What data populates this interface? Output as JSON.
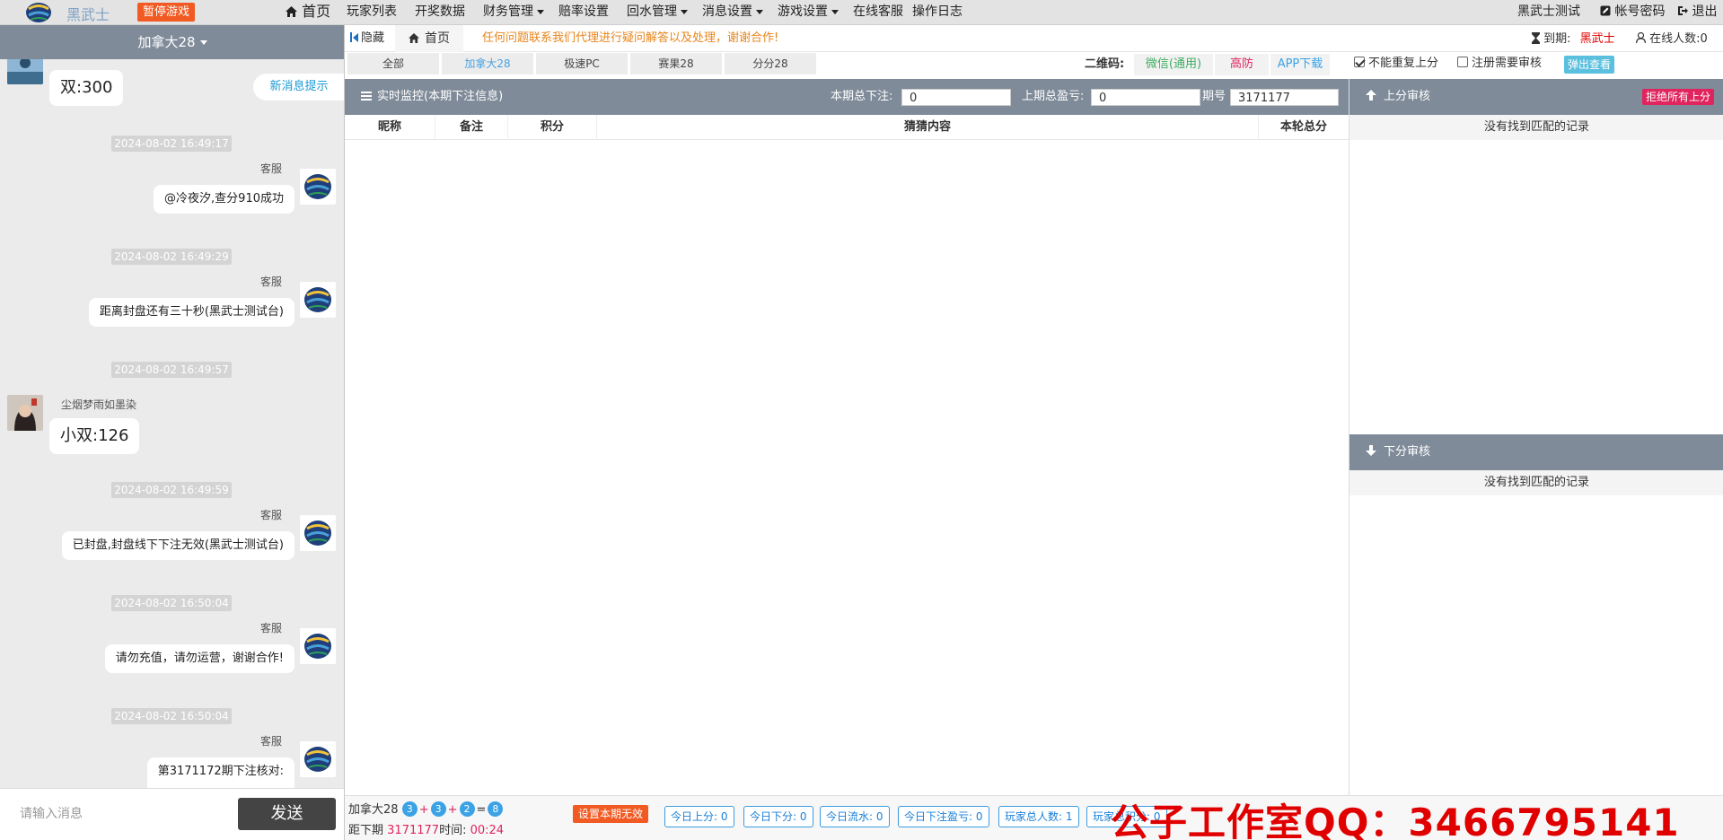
{
  "nav": {
    "logo_text": "黑武士",
    "pause_label": "暂停游戏",
    "home": "首页",
    "players": "玩家列表",
    "draw_data": "开奖数据",
    "finance": "财务管理",
    "odds": "赔率设置",
    "rebate": "回水管理",
    "message": "消息设置",
    "game": "游戏设置",
    "service": "在线客服",
    "log": "操作日志",
    "user": "黑武士测试",
    "password": "帐号密码",
    "logout": "退出"
  },
  "chat": {
    "room": "加拿大28",
    "new_msg": "新消息提示",
    "messages": [
      {
        "type": "left-bubble",
        "sender": "",
        "text": "双:300"
      },
      {
        "type": "time",
        "text": "2024-08-02 16:49:17"
      },
      {
        "type": "right-bubble",
        "sender": "客服",
        "text": "@冷夜汐,查分910成功"
      },
      {
        "type": "time",
        "text": "2024-08-02 16:49:29"
      },
      {
        "type": "right-bubble",
        "sender": "客服",
        "text": "距离封盘还有三十秒(黑武士测试台)"
      },
      {
        "type": "time",
        "text": "2024-08-02 16:49:57"
      },
      {
        "type": "left-bubble",
        "sender": "尘烟梦雨如墨染",
        "text": "小双:126"
      },
      {
        "type": "time",
        "text": "2024-08-02 16:49:59"
      },
      {
        "type": "right-bubble",
        "sender": "客服",
        "text": "已封盘,封盘线下下注无效(黑武士测试台)"
      },
      {
        "type": "time",
        "text": "2024-08-02 16:50:04"
      },
      {
        "type": "right-bubble",
        "sender": "客服",
        "text": "请勿充值，请勿运营，谢谢合作!"
      },
      {
        "type": "time",
        "text": "2024-08-02 16:50:04"
      },
      {
        "type": "right-bubble",
        "sender": "客服",
        "text": "第3171172期下注核对:"
      }
    ],
    "input_placeholder": "请输入消息",
    "send_label": "发送"
  },
  "tabs": {
    "hide": "隐藏",
    "home": "首页",
    "notice": "任何问题联系我们代理进行疑问解答以及处理，谢谢合作!"
  },
  "games": [
    "全部",
    "加拿大28",
    "极速PC",
    "赛果28",
    "分分28"
  ],
  "active_game": "加拿大28",
  "qr": {
    "label": "二维码:",
    "wechat": "微信(通用)",
    "antiblock": "高防",
    "app": "APP下载"
  },
  "options": {
    "no_repeat": "不能重复上分",
    "register_review": "注册需要审核",
    "popup": "弹出查看"
  },
  "monitor": {
    "title": "实时监控(本期下注信息)",
    "total_bet_label": "本期总下注:",
    "total_bet_value": "0",
    "last_profit_label": "上期总盈亏:",
    "last_profit_value": "0",
    "period_label": "期号",
    "period_value": "3171177"
  },
  "table": {
    "columns": [
      "昵称",
      "备注",
      "积分",
      "猜猜内容",
      "本轮总分"
    ]
  },
  "audit": {
    "expire_label": "到期:",
    "expire_value": "黑武士",
    "online_label": "在线人数:",
    "online_value": "0",
    "up_title": "上分审核",
    "reject_all": "拒绝所有上分",
    "up_empty": "没有找到匹配的记录",
    "down_title": "下分审核",
    "down_empty": "没有找到匹配的记录"
  },
  "status": {
    "game": "加拿大28",
    "balls": [
      "3",
      "3",
      "2",
      "8"
    ],
    "next_label": "距下期",
    "next_period": "3171177",
    "time_label": "时间:",
    "time_value": "00:24",
    "void_label": "设置本期无效",
    "stats": [
      "今日上分: 0",
      "今日下分: 0",
      "今日流水: 0",
      "今日下注盈亏: 0",
      "玩家总人数: 1",
      "玩家总积分: 0"
    ],
    "watermark": "公子工作室QQ：3466795141"
  },
  "colors": {
    "header_bg": "#7f8b99",
    "accent_orange": "#f15a22",
    "accent_red": "#e0245e",
    "accent_blue": "#3aa2e5"
  }
}
